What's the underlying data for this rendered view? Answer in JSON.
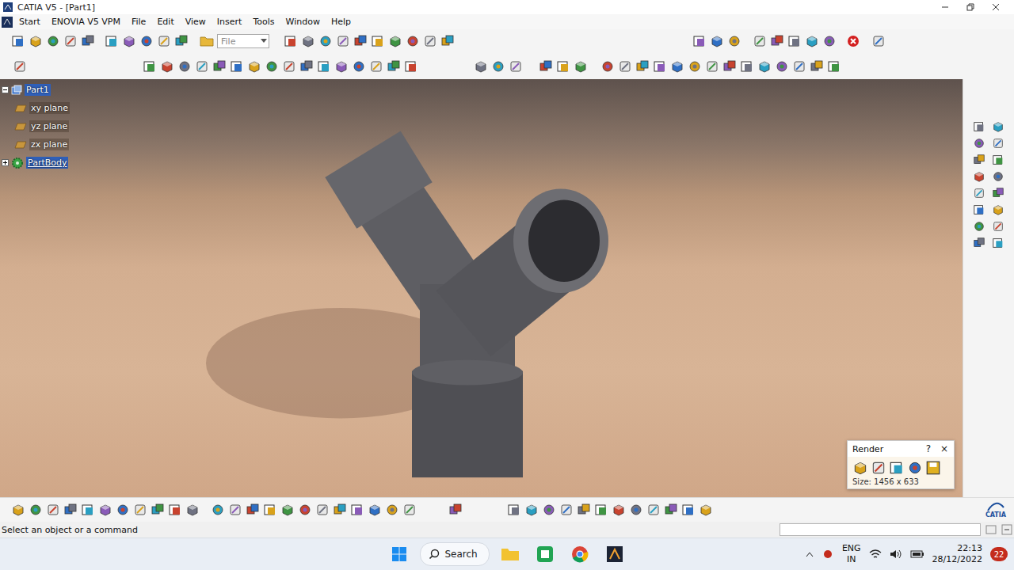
{
  "window": {
    "title": "CATIA V5 - [Part1]"
  },
  "menu": [
    "Start",
    "ENOVIA V5 VPM",
    "File",
    "Edit",
    "View",
    "Insert",
    "Tools",
    "Window",
    "Help"
  ],
  "toolbar": {
    "file_select": "File"
  },
  "tree": [
    {
      "label": "Part1",
      "kind": "root",
      "expanded": true,
      "selected": true
    },
    {
      "label": "xy plane",
      "kind": "plane",
      "selected": false
    },
    {
      "label": "yz plane",
      "kind": "plane",
      "selected": false
    },
    {
      "label": "zx plane",
      "kind": "plane",
      "selected": false
    },
    {
      "label": "PartBody",
      "kind": "body",
      "expanded": false,
      "selected": true
    }
  ],
  "render_dialog": {
    "title": "Render",
    "help": "?",
    "close": "×",
    "size": "Size: 1456 x 633"
  },
  "logo": {
    "text": "CATIA"
  },
  "status_bar": {
    "prompt": "Select an object or a command",
    "command_input": ""
  },
  "taskbar": {
    "search": "Search",
    "language": [
      "ENG",
      "IN"
    ],
    "time": "22:13",
    "date": "28/12/2022",
    "notifications": "22"
  }
}
